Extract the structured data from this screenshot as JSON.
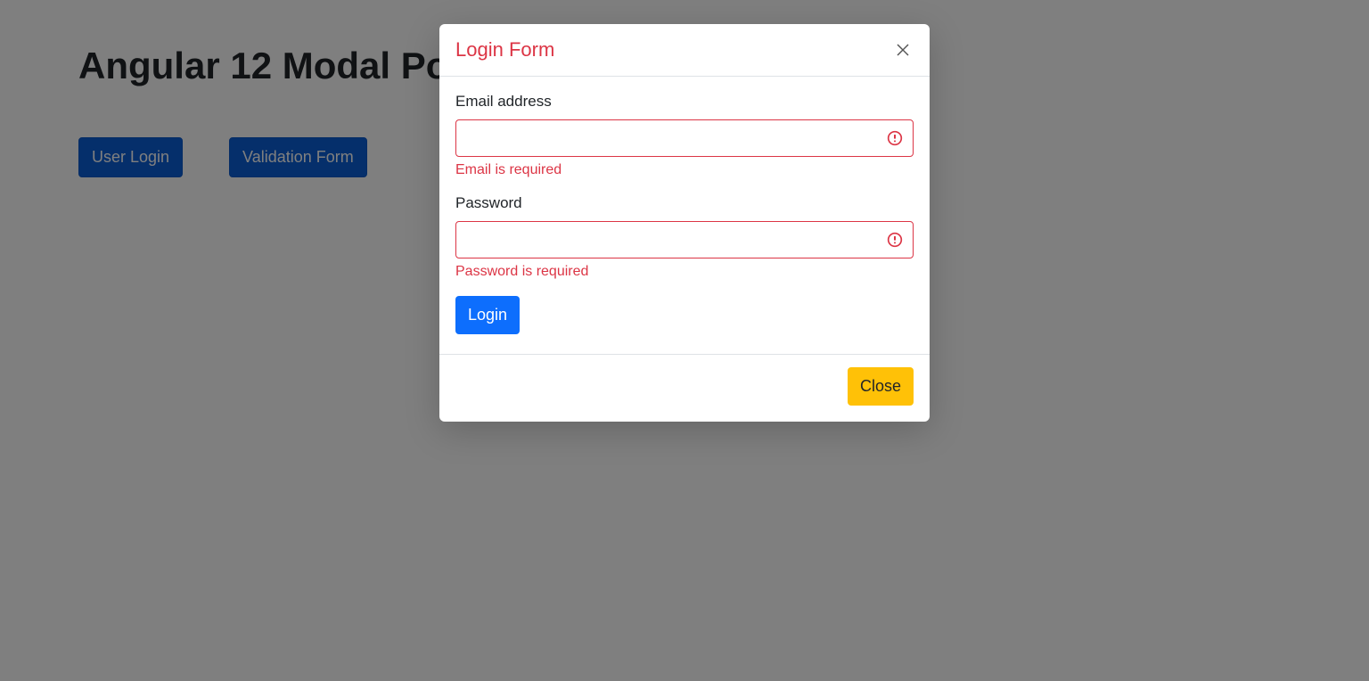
{
  "page": {
    "title": "Angular 12 Modal Popup"
  },
  "buttons": {
    "user_login": "User Login",
    "validation_form": "Validation Form"
  },
  "modal": {
    "title": "Login Form",
    "email": {
      "label": "Email address",
      "value": "",
      "error": "Email is required"
    },
    "password": {
      "label": "Password",
      "value": "",
      "error": "Password is required"
    },
    "login_button": "Login",
    "close_button": "Close"
  }
}
